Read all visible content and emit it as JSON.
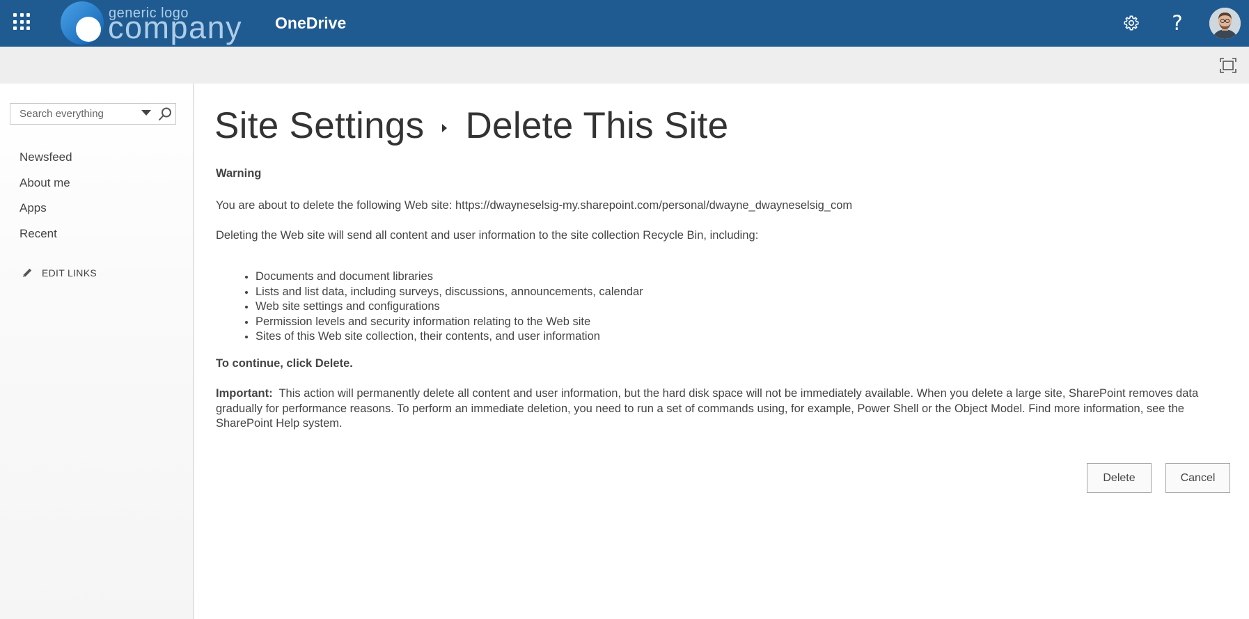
{
  "suitebar": {
    "app_name": "OneDrive",
    "logo_small": "generic logo",
    "logo_big": "company",
    "help_label": "?",
    "icons": {
      "waffle": "app-launcher-icon",
      "settings": "gear-icon",
      "help": "help-icon",
      "focus": "focus-mode-icon"
    },
    "colors": {
      "bar": "#1f5b91",
      "logo_text": "#aecde8"
    }
  },
  "leftnav": {
    "search": {
      "placeholder": "Search everything"
    },
    "items": [
      {
        "label": "Newsfeed"
      },
      {
        "label": "About me"
      },
      {
        "label": "Apps"
      },
      {
        "label": "Recent"
      }
    ],
    "edit_links": "EDIT LINKS"
  },
  "main": {
    "breadcrumb": {
      "parent": "Site Settings",
      "current": "Delete This Site"
    },
    "warning_heading": "Warning",
    "about_to_delete": "You are about to delete the following Web site: https://dwayneselsig-my.sharepoint.com/personal/dwayne_dwayneselsig_com",
    "recycle_intro": "Deleting the Web site will send all content and user information to the site collection Recycle Bin, including:",
    "bullets": [
      "Documents and document libraries",
      "Lists and list data, including surveys, discussions, announcements, calendar",
      "Web site settings and configurations",
      "Permission levels and security information relating to the Web site",
      "Sites of this Web site collection, their contents, and user information"
    ],
    "continue_text": "To continue, click Delete.",
    "important_label": "Important:",
    "important_text": "This action will permanently delete all content and user information, but the hard disk space will not be immediately available. When you delete a large site, SharePoint removes data gradually for performance reasons. To perform an immediate deletion, you need to run a set of commands using, for example, Power Shell or the Object Model. Find more information, see the SharePoint Help system.",
    "buttons": {
      "delete": "Delete",
      "cancel": "Cancel"
    }
  }
}
